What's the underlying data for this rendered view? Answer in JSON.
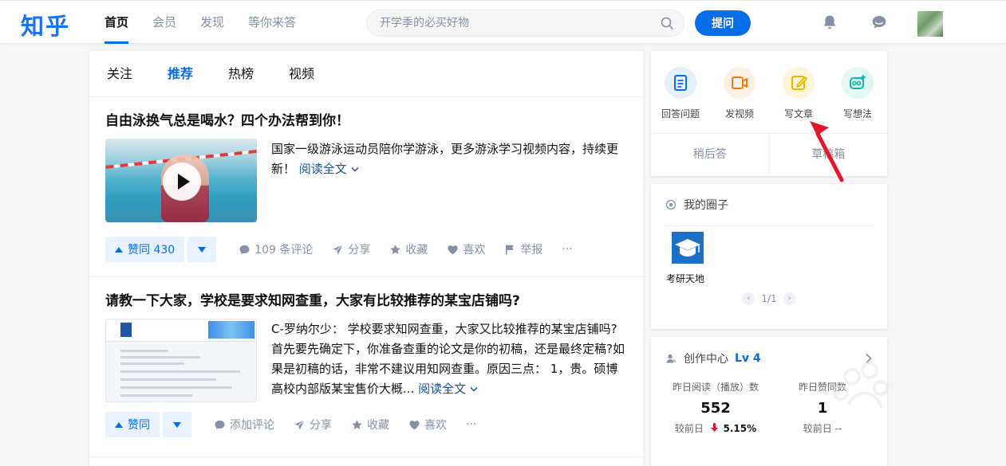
{
  "header": {
    "logo": "知乎",
    "nav": [
      "首页",
      "会员",
      "发现",
      "等你来答"
    ],
    "search_placeholder": "开学季的必买好物",
    "ask_label": "提问"
  },
  "feed": {
    "tabs": [
      "关注",
      "推荐",
      "热榜",
      "视频"
    ],
    "active_tab": "推荐",
    "items": [
      {
        "title": "自由泳换气总是喝水？四个办法帮到你！",
        "excerpt": "国家一级游泳运动员陪你学游泳，更多游泳学习视频内容，持续更新！",
        "read_more": "阅读全文",
        "vote_label": "赞同 430",
        "comment_label": "109 条评论",
        "share_label": "分享",
        "collect_label": "收藏",
        "like_label": "喜欢",
        "report_label": "举报",
        "more_label": "···"
      },
      {
        "title": "请教一下大家，学校是要求知网查重，大家有比较推荐的某宝店铺吗?",
        "excerpt": "C-罗纳尔少： 学校要求知网查重，大家又比较推荐的某宝店铺吗?首先要先确定下，你准备查重的论文是你的初稿，还是最终定稿?如果是初稿的话，非常不建议用知网查重。原因三点： 1，贵。硕博高校内部版某宝售价大概...",
        "read_more": "阅读全文",
        "vote_label": "赞同",
        "comment_label": "添加评论",
        "share_label": "分享",
        "collect_label": "收藏",
        "like_label": "喜欢",
        "more_label": "···"
      }
    ]
  },
  "creator": {
    "actions": [
      "回答问题",
      "发视频",
      "写文章",
      "写想法"
    ],
    "drafts": [
      "稍后答",
      "草稿箱"
    ]
  },
  "circles": {
    "title": "我的圈子",
    "item_name": "考研天地",
    "pager": "1/1"
  },
  "creation_center": {
    "title": "创作中心",
    "level": "Lv 4",
    "stat1_label": "昨日阅读（播放）数",
    "stat1_value": "552",
    "stat1_compare": "较前日",
    "stat1_change": "5.15%",
    "stat2_label": "昨日赞同数",
    "stat2_value": "1",
    "stat2_compare": "较前日 --"
  },
  "colors": {
    "brand_blue": "#056de8",
    "logo_blue": "#1772f6",
    "annotation_red": "#e8142a"
  }
}
